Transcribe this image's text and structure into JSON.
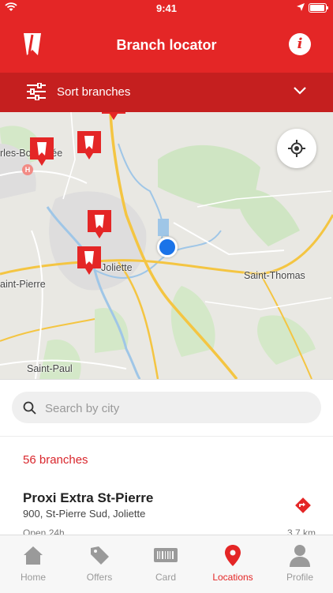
{
  "status_bar": {
    "time": "9:41"
  },
  "header": {
    "title": "Branch locator",
    "logo_icon": "bookmark-logo-icon",
    "info_icon": "info-icon",
    "info_glyph": "i"
  },
  "sort_bar": {
    "label": "Sort branches",
    "icon": "sliders-icon",
    "chevron": "chevron-down-icon"
  },
  "map": {
    "labels": {
      "charles": "rles-Borromée",
      "joliette": "Joliette",
      "saint_thomas": "Saint-Thomas",
      "saint_pierre": "aint-Pierre",
      "saint_paul": "Saint-Paul",
      "hospital": "H"
    },
    "locate_icon": "crosshair-icon"
  },
  "search": {
    "placeholder": "Search by city",
    "value": ""
  },
  "branches": {
    "count_label": "56 branches",
    "items": [
      {
        "name": "Proxi Extra St-Pierre",
        "address": "900, St-Pierre Sud, Joliette",
        "hours": "Open 24h",
        "distance": "3.7 km"
      }
    ]
  },
  "tabs": [
    {
      "label": "Home",
      "icon": "home-icon",
      "active": false
    },
    {
      "label": "Offers",
      "icon": "tag-icon",
      "active": false
    },
    {
      "label": "Card",
      "icon": "barcode-card-icon",
      "active": false
    },
    {
      "label": "Locations",
      "icon": "location-pin-icon",
      "active": true
    },
    {
      "label": "Profile",
      "icon": "person-icon",
      "active": false
    }
  ],
  "colors": {
    "brand_red": "#e42626",
    "dark_red": "#c51f1f",
    "user_dot": "#1a73e8"
  }
}
